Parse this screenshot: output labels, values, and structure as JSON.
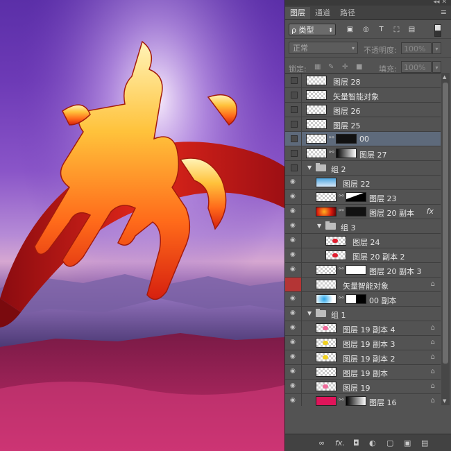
{
  "panel": {
    "collapse_glyph": "◂◂",
    "close_glyph": "✕",
    "tabs": [
      "图层",
      "通道",
      "路径"
    ],
    "menu_glyph": "≡",
    "filter": {
      "label": "ρ 类型",
      "caret": "⬍"
    },
    "filter_icons": [
      "▣",
      "◎",
      "T",
      "⬚",
      "▤"
    ],
    "blend_mode": "正常",
    "caret": "▾",
    "opacity_label": "不透明度:",
    "opacity_value": "100%",
    "lock_label": "锁定:",
    "lock_icons": [
      "▦",
      "✎",
      "✛",
      "■"
    ],
    "fill_label": "填充:",
    "fill_value": "100%",
    "scroll_up": "▲",
    "scroll_down": "▼",
    "bottom_icons": [
      "∞",
      "fx.",
      "◘",
      "◐",
      "▢",
      "▣",
      "▤"
    ]
  },
  "layers": [
    {
      "name": "图层 28",
      "eye": "box",
      "indent": 0,
      "thumb": "checker"
    },
    {
      "name": "矢量智能对象",
      "eye": "box",
      "indent": 0,
      "thumb": "checker"
    },
    {
      "name": "图层 26",
      "eye": "box",
      "indent": 0,
      "thumb": "checker"
    },
    {
      "name": "图层 25",
      "eye": "box",
      "indent": 0,
      "thumb": "checker"
    },
    {
      "name": "00",
      "eye": "box",
      "indent": 0,
      "thumb": "checker",
      "mask": "black",
      "selected": true
    },
    {
      "name": "图层 27",
      "eye": "box",
      "indent": 0,
      "thumb": "checker",
      "mask": "gradient"
    },
    {
      "name": "组 2",
      "eye": "box",
      "group": true,
      "indent": 0
    },
    {
      "name": "图层 22",
      "eye": "on",
      "indent": 1,
      "thumb": "sky"
    },
    {
      "name": "图层 23",
      "eye": "on",
      "indent": 1,
      "thumb": "checker",
      "mask": "diag"
    },
    {
      "name": "图层 20 副本",
      "eye": "on",
      "indent": 1,
      "thumb": "red",
      "mask": "black",
      "fx": true
    },
    {
      "name": "组 3",
      "eye": "on",
      "group": true,
      "indent": 1
    },
    {
      "name": "图层 24",
      "eye": "on",
      "indent": 2,
      "thumb": "checker-red"
    },
    {
      "name": "图层 20 副本 2",
      "eye": "on",
      "indent": 2,
      "thumb": "checker-red"
    },
    {
      "name": "图层 20 副本 3",
      "eye": "on",
      "indent": 1,
      "thumb": "checker",
      "mask": "white"
    },
    {
      "name": "矢量智能对象",
      "eye": "red",
      "indent": 1,
      "thumb": "checker",
      "lock": true
    },
    {
      "name": "00 副本",
      "eye": "on",
      "indent": 1,
      "thumb": "cyan",
      "mask": "bw"
    },
    {
      "name": "组 1",
      "eye": "on",
      "group": true,
      "indent": 0
    },
    {
      "name": "图层 19 副本 4",
      "eye": "on",
      "indent": 1,
      "thumb": "checker-pink",
      "lock": true
    },
    {
      "name": "图层 19 副本 3",
      "eye": "on",
      "indent": 1,
      "thumb": "checker-yellow",
      "lock": true
    },
    {
      "name": "图层 19 副本 2",
      "eye": "on",
      "indent": 1,
      "thumb": "checker-yellow",
      "lock": true
    },
    {
      "name": "图层 19 副本",
      "eye": "on",
      "indent": 1,
      "thumb": "checker",
      "lock": true
    },
    {
      "name": "图层 19",
      "eye": "on",
      "indent": 1,
      "thumb": "checker-pink",
      "lock": true
    },
    {
      "name": "图层 16",
      "eye": "on",
      "indent": 1,
      "thumb": "magenta",
      "mask": "gradient",
      "lock": true
    }
  ],
  "colors": {
    "panel_bg": "#535353",
    "selected_row": "#5e6a7b",
    "hidden_eye_highlight": "#b43535"
  }
}
